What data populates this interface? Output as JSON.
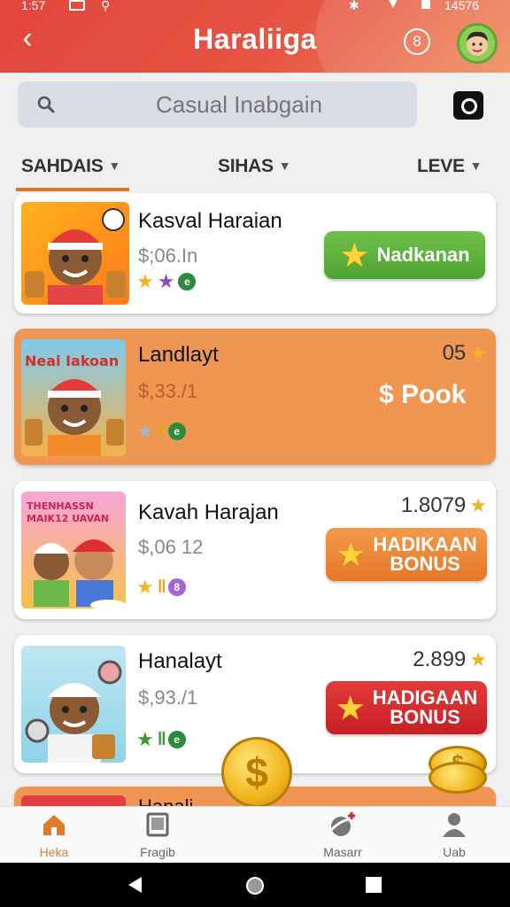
{
  "status_bar": {
    "time": "1:57",
    "battery": "14576"
  },
  "header": {
    "title": "Haraliiga",
    "notification_count": "8"
  },
  "search": {
    "placeholder": "Casual Inabgain"
  },
  "filters": [
    {
      "label": "SAHDAIS"
    },
    {
      "label": "SIHAS"
    },
    {
      "label": "LEVE"
    }
  ],
  "cards": [
    {
      "name": "Kasval Haraian",
      "price": "$;06.In",
      "cta": "Nadkanan",
      "cta_color": "#5bb23c"
    },
    {
      "name": "Landlayt",
      "price": "$,33./1",
      "rating": "05",
      "cta": "$ Pook",
      "thumb_caption": "Neai Iakoan"
    },
    {
      "name": "Kavah Harajan",
      "price": "$,06 12",
      "rating": "1.8079",
      "cta_line1": "HADIKAAN",
      "cta_line2": "BONUS",
      "cta_color": "#ea8533",
      "thumb_caption_1": "THENHASSN",
      "thumb_caption_2": "MAIK12 UAVAN"
    },
    {
      "name": "Hanalayt",
      "price": "$,93./1",
      "rating": "2.899",
      "cta_line1": "HADIGAAN",
      "cta_line2": "BONUS",
      "cta_color": "#d42a2f"
    },
    {
      "name": "Hanali"
    }
  ],
  "bottom_nav": [
    {
      "label": "Heka",
      "icon": "home-icon",
      "active": true
    },
    {
      "label": "Fragib",
      "icon": "tablet-icon"
    },
    {
      "label": "Masarr",
      "icon": "planet-icon"
    },
    {
      "label": "Uab",
      "icon": "user-icon"
    }
  ],
  "colors": {
    "header": "#e2463c",
    "accent": "#e07b2e",
    "highlight_card": "#ee9652"
  }
}
